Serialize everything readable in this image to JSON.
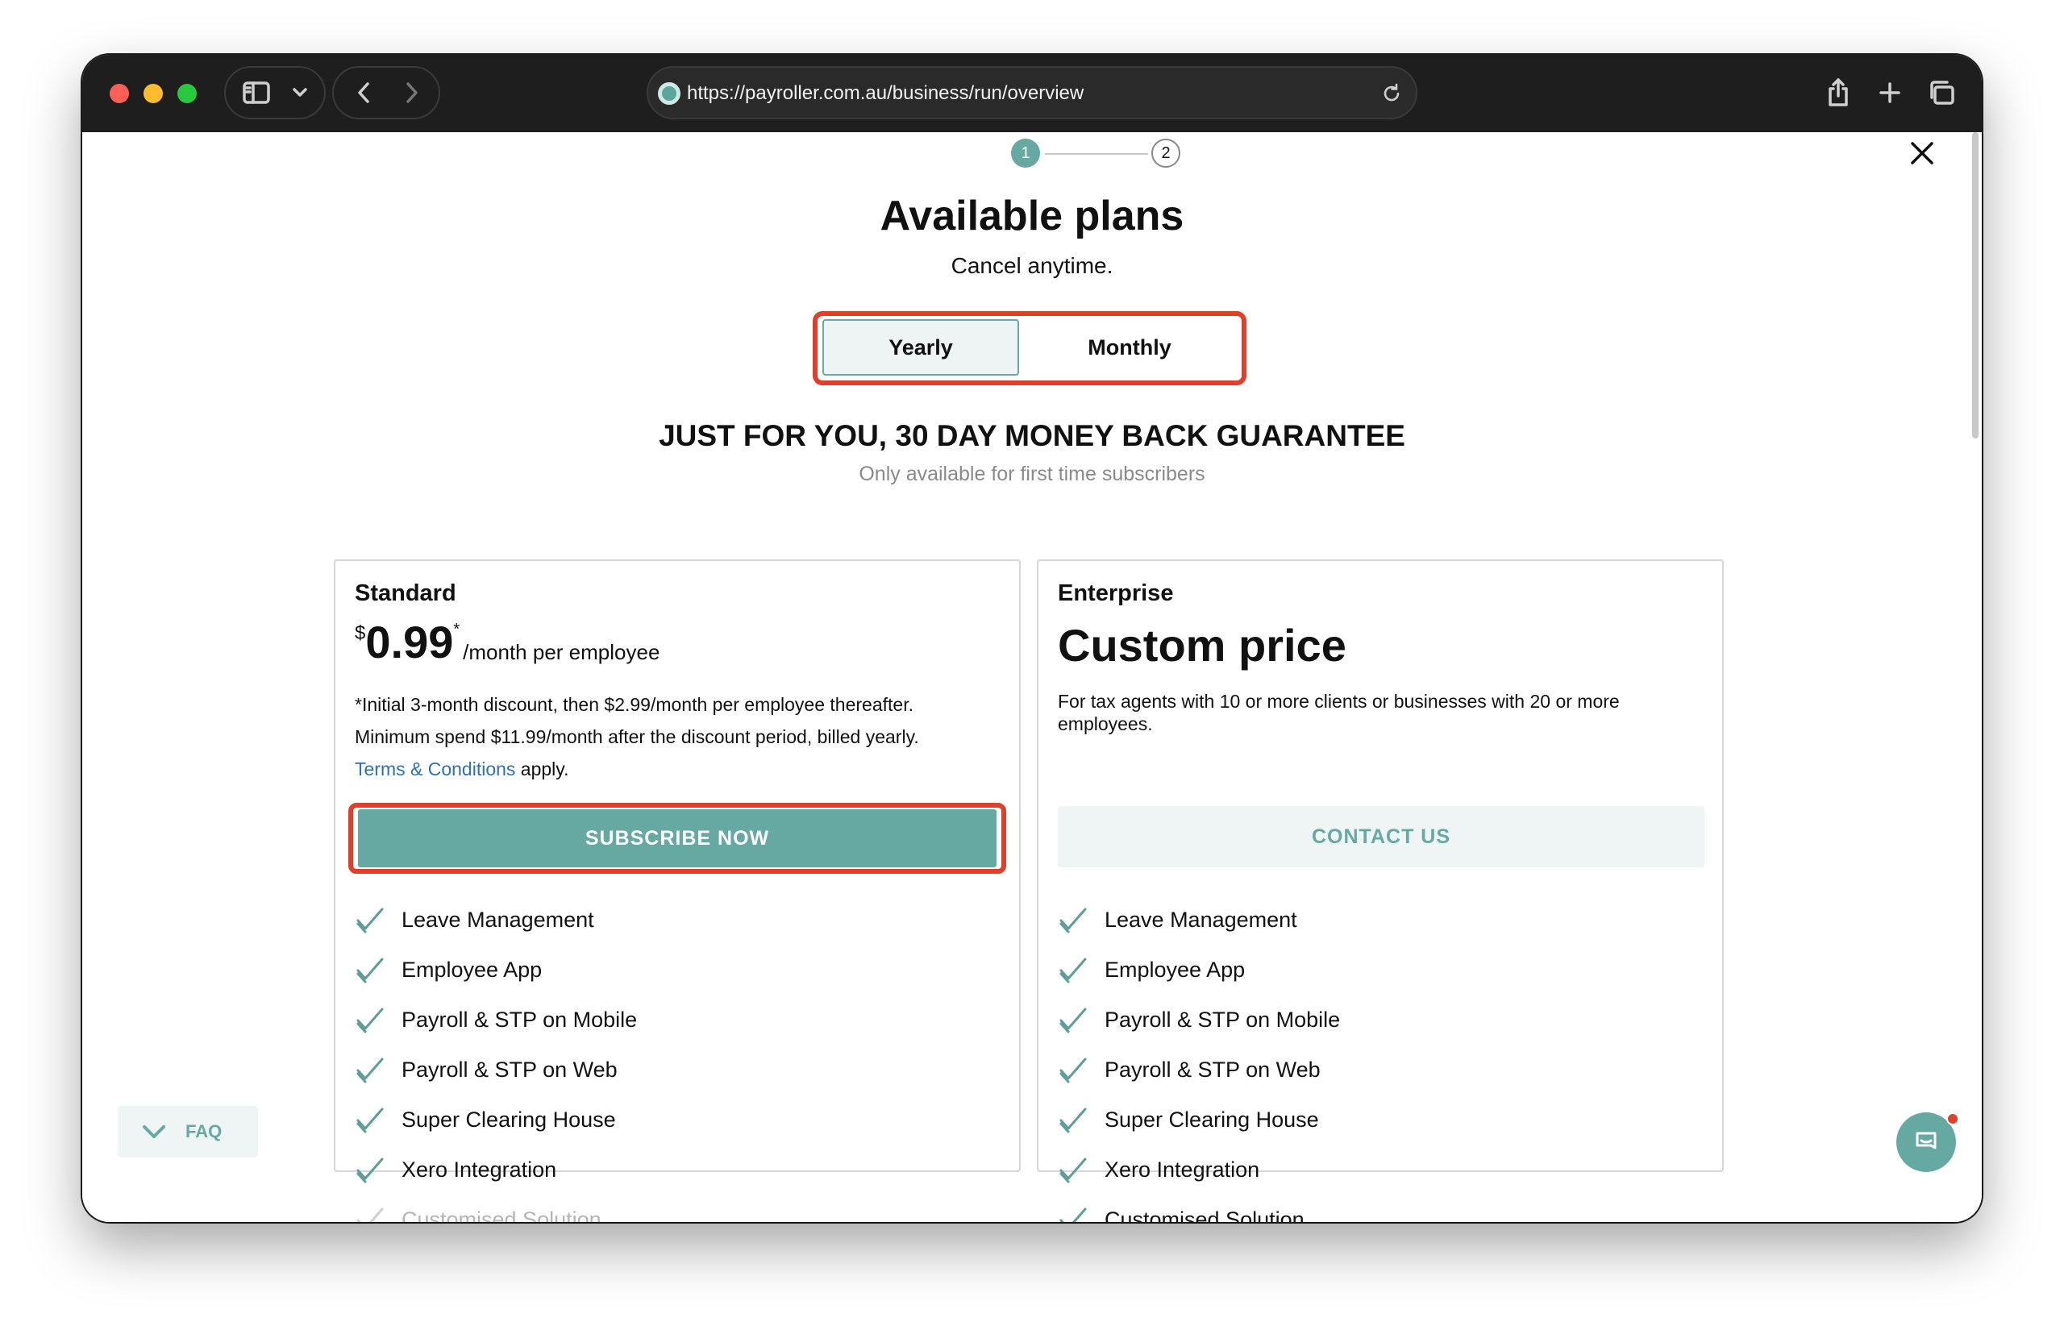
{
  "browser": {
    "url": "https://payroller.com.au/business/run/overview"
  },
  "stepper": {
    "step1": "1",
    "step2": "2"
  },
  "header": {
    "title": "Available plans",
    "subtitle": "Cancel anytime."
  },
  "billing_toggle": {
    "yearly_label": "Yearly",
    "monthly_label": "Monthly",
    "selected": "Yearly"
  },
  "promo": {
    "headline": "JUST FOR YOU, 30 DAY MONEY BACK GUARANTEE",
    "note": "Only available for first time subscribers"
  },
  "plans": [
    {
      "name": "Standard",
      "currency": "$",
      "amount": "0.99",
      "asterisk": "*",
      "per": "/month per employee",
      "fine_line1": "*Initial 3-month discount, then $2.99/month per employee thereafter.",
      "fine_line2": "Minimum spend $11.99/month after the discount period, billed yearly.",
      "terms_link": "Terms & Conditions",
      "terms_suffix": " apply.",
      "cta": "SUBSCRIBE NOW",
      "features": [
        {
          "label": "Leave Management",
          "enabled": true
        },
        {
          "label": "Employee App",
          "enabled": true
        },
        {
          "label": "Payroll & STP on Mobile",
          "enabled": true
        },
        {
          "label": "Payroll & STP on Web",
          "enabled": true
        },
        {
          "label": "Super Clearing House",
          "enabled": true
        },
        {
          "label": "Xero Integration",
          "enabled": true
        },
        {
          "label": "Customised Solution",
          "enabled": false
        }
      ]
    },
    {
      "name": "Enterprise",
      "price_text": "Custom price",
      "description": "For tax agents with 10 or more clients or businesses with 20 or more employees.",
      "cta": "CONTACT US",
      "features": [
        {
          "label": "Leave Management",
          "enabled": true
        },
        {
          "label": "Employee App",
          "enabled": true
        },
        {
          "label": "Payroll & STP on Mobile",
          "enabled": true
        },
        {
          "label": "Payroll & STP on Web",
          "enabled": true
        },
        {
          "label": "Super Clearing House",
          "enabled": true
        },
        {
          "label": "Xero Integration",
          "enabled": true
        },
        {
          "label": "Customised Solution",
          "enabled": true
        }
      ]
    }
  ],
  "faq": {
    "label": "FAQ"
  },
  "colors": {
    "accent": "#66a9a3",
    "highlight": "#e0402a",
    "link": "#2f6fb5"
  }
}
